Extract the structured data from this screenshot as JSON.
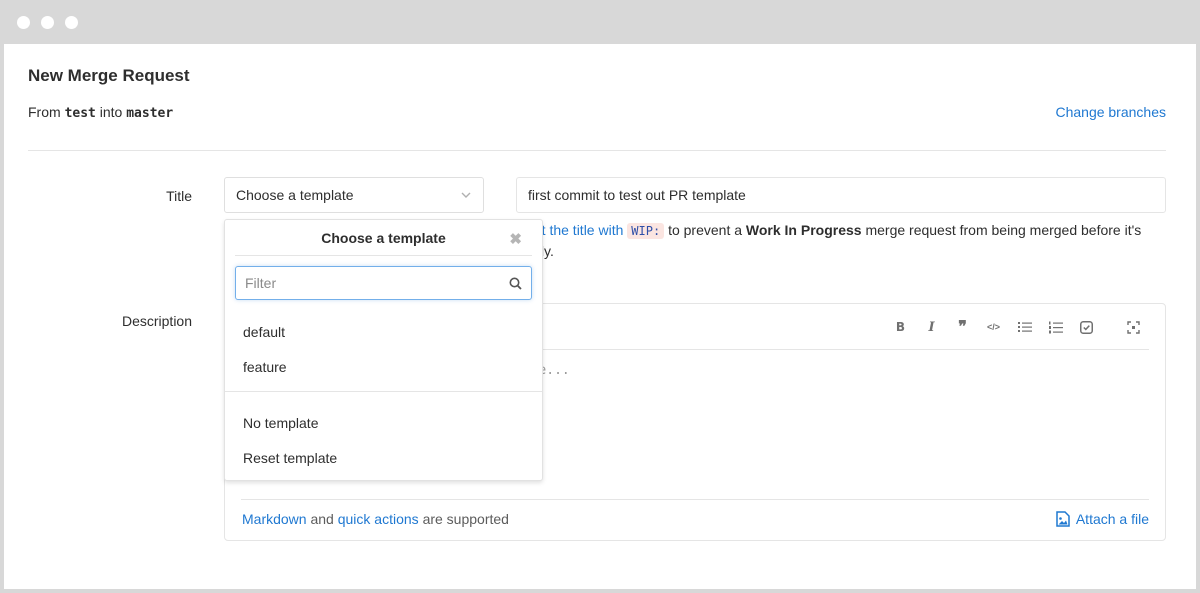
{
  "window": {
    "controls": [
      "dot",
      "dot",
      "dot"
    ]
  },
  "header": {
    "title": "New Merge Request",
    "from_prefix": "From",
    "source_branch": "test",
    "into_word": "into",
    "target_branch": "master",
    "change_branches_label": "Change branches"
  },
  "form": {
    "title_label": "Title",
    "template_select_value": "Choose a template",
    "title_value": "first commit to test out PR template",
    "hint": {
      "link_text": "Start the title with",
      "code": "WIP:",
      "middle": "to prevent a",
      "bold": "Work In Progress",
      "end": "merge request from being merged before it's ready."
    },
    "description_label": "Description",
    "description_placeholder": "Write a comment or drag your files here...",
    "toolbar": [
      {
        "name": "bold-icon",
        "glyph": "B"
      },
      {
        "name": "italic-icon",
        "glyph": "I"
      },
      {
        "name": "quote-icon",
        "glyph": "❞"
      },
      {
        "name": "code-icon",
        "glyph": "</>"
      },
      {
        "name": "bullet-list-icon",
        "glyph": "☰"
      },
      {
        "name": "numbered-list-icon",
        "glyph": "☰"
      },
      {
        "name": "task-list-icon",
        "glyph": "☑"
      },
      {
        "name": "fullscreen-icon",
        "glyph": "⛶"
      }
    ],
    "footer": {
      "markdown_link": "Markdown",
      "and_word": "and",
      "quick_actions_link": "quick actions",
      "supported_text": "are supported",
      "attach_label": "Attach a file"
    }
  },
  "dropdown": {
    "title": "Choose a template",
    "filter_placeholder": "Filter",
    "filter_value": "",
    "templates": [
      "default",
      "feature"
    ],
    "actions": [
      "No template",
      "Reset template"
    ]
  },
  "colors": {
    "link": "#1f78d1",
    "text": "#2e2e2e",
    "focus_border": "#73afea",
    "code_bg": "#fbe5e1"
  }
}
